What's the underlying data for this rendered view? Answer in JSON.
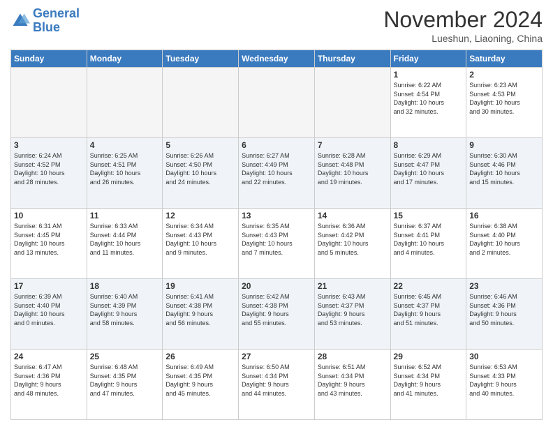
{
  "logo": {
    "line1": "General",
    "line2": "Blue"
  },
  "header": {
    "month": "November 2024",
    "location": "Lueshun, Liaoning, China"
  },
  "weekdays": [
    "Sunday",
    "Monday",
    "Tuesday",
    "Wednesday",
    "Thursday",
    "Friday",
    "Saturday"
  ],
  "weeks": [
    [
      {
        "day": "",
        "info": ""
      },
      {
        "day": "",
        "info": ""
      },
      {
        "day": "",
        "info": ""
      },
      {
        "day": "",
        "info": ""
      },
      {
        "day": "",
        "info": ""
      },
      {
        "day": "1",
        "info": "Sunrise: 6:22 AM\nSunset: 4:54 PM\nDaylight: 10 hours\nand 32 minutes."
      },
      {
        "day": "2",
        "info": "Sunrise: 6:23 AM\nSunset: 4:53 PM\nDaylight: 10 hours\nand 30 minutes."
      }
    ],
    [
      {
        "day": "3",
        "info": "Sunrise: 6:24 AM\nSunset: 4:52 PM\nDaylight: 10 hours\nand 28 minutes."
      },
      {
        "day": "4",
        "info": "Sunrise: 6:25 AM\nSunset: 4:51 PM\nDaylight: 10 hours\nand 26 minutes."
      },
      {
        "day": "5",
        "info": "Sunrise: 6:26 AM\nSunset: 4:50 PM\nDaylight: 10 hours\nand 24 minutes."
      },
      {
        "day": "6",
        "info": "Sunrise: 6:27 AM\nSunset: 4:49 PM\nDaylight: 10 hours\nand 22 minutes."
      },
      {
        "day": "7",
        "info": "Sunrise: 6:28 AM\nSunset: 4:48 PM\nDaylight: 10 hours\nand 19 minutes."
      },
      {
        "day": "8",
        "info": "Sunrise: 6:29 AM\nSunset: 4:47 PM\nDaylight: 10 hours\nand 17 minutes."
      },
      {
        "day": "9",
        "info": "Sunrise: 6:30 AM\nSunset: 4:46 PM\nDaylight: 10 hours\nand 15 minutes."
      }
    ],
    [
      {
        "day": "10",
        "info": "Sunrise: 6:31 AM\nSunset: 4:45 PM\nDaylight: 10 hours\nand 13 minutes."
      },
      {
        "day": "11",
        "info": "Sunrise: 6:33 AM\nSunset: 4:44 PM\nDaylight: 10 hours\nand 11 minutes."
      },
      {
        "day": "12",
        "info": "Sunrise: 6:34 AM\nSunset: 4:43 PM\nDaylight: 10 hours\nand 9 minutes."
      },
      {
        "day": "13",
        "info": "Sunrise: 6:35 AM\nSunset: 4:43 PM\nDaylight: 10 hours\nand 7 minutes."
      },
      {
        "day": "14",
        "info": "Sunrise: 6:36 AM\nSunset: 4:42 PM\nDaylight: 10 hours\nand 5 minutes."
      },
      {
        "day": "15",
        "info": "Sunrise: 6:37 AM\nSunset: 4:41 PM\nDaylight: 10 hours\nand 4 minutes."
      },
      {
        "day": "16",
        "info": "Sunrise: 6:38 AM\nSunset: 4:40 PM\nDaylight: 10 hours\nand 2 minutes."
      }
    ],
    [
      {
        "day": "17",
        "info": "Sunrise: 6:39 AM\nSunset: 4:40 PM\nDaylight: 10 hours\nand 0 minutes."
      },
      {
        "day": "18",
        "info": "Sunrise: 6:40 AM\nSunset: 4:39 PM\nDaylight: 9 hours\nand 58 minutes."
      },
      {
        "day": "19",
        "info": "Sunrise: 6:41 AM\nSunset: 4:38 PM\nDaylight: 9 hours\nand 56 minutes."
      },
      {
        "day": "20",
        "info": "Sunrise: 6:42 AM\nSunset: 4:38 PM\nDaylight: 9 hours\nand 55 minutes."
      },
      {
        "day": "21",
        "info": "Sunrise: 6:43 AM\nSunset: 4:37 PM\nDaylight: 9 hours\nand 53 minutes."
      },
      {
        "day": "22",
        "info": "Sunrise: 6:45 AM\nSunset: 4:37 PM\nDaylight: 9 hours\nand 51 minutes."
      },
      {
        "day": "23",
        "info": "Sunrise: 6:46 AM\nSunset: 4:36 PM\nDaylight: 9 hours\nand 50 minutes."
      }
    ],
    [
      {
        "day": "24",
        "info": "Sunrise: 6:47 AM\nSunset: 4:36 PM\nDaylight: 9 hours\nand 48 minutes."
      },
      {
        "day": "25",
        "info": "Sunrise: 6:48 AM\nSunset: 4:35 PM\nDaylight: 9 hours\nand 47 minutes."
      },
      {
        "day": "26",
        "info": "Sunrise: 6:49 AM\nSunset: 4:35 PM\nDaylight: 9 hours\nand 45 minutes."
      },
      {
        "day": "27",
        "info": "Sunrise: 6:50 AM\nSunset: 4:34 PM\nDaylight: 9 hours\nand 44 minutes."
      },
      {
        "day": "28",
        "info": "Sunrise: 6:51 AM\nSunset: 4:34 PM\nDaylight: 9 hours\nand 43 minutes."
      },
      {
        "day": "29",
        "info": "Sunrise: 6:52 AM\nSunset: 4:34 PM\nDaylight: 9 hours\nand 41 minutes."
      },
      {
        "day": "30",
        "info": "Sunrise: 6:53 AM\nSunset: 4:33 PM\nDaylight: 9 hours\nand 40 minutes."
      }
    ]
  ]
}
